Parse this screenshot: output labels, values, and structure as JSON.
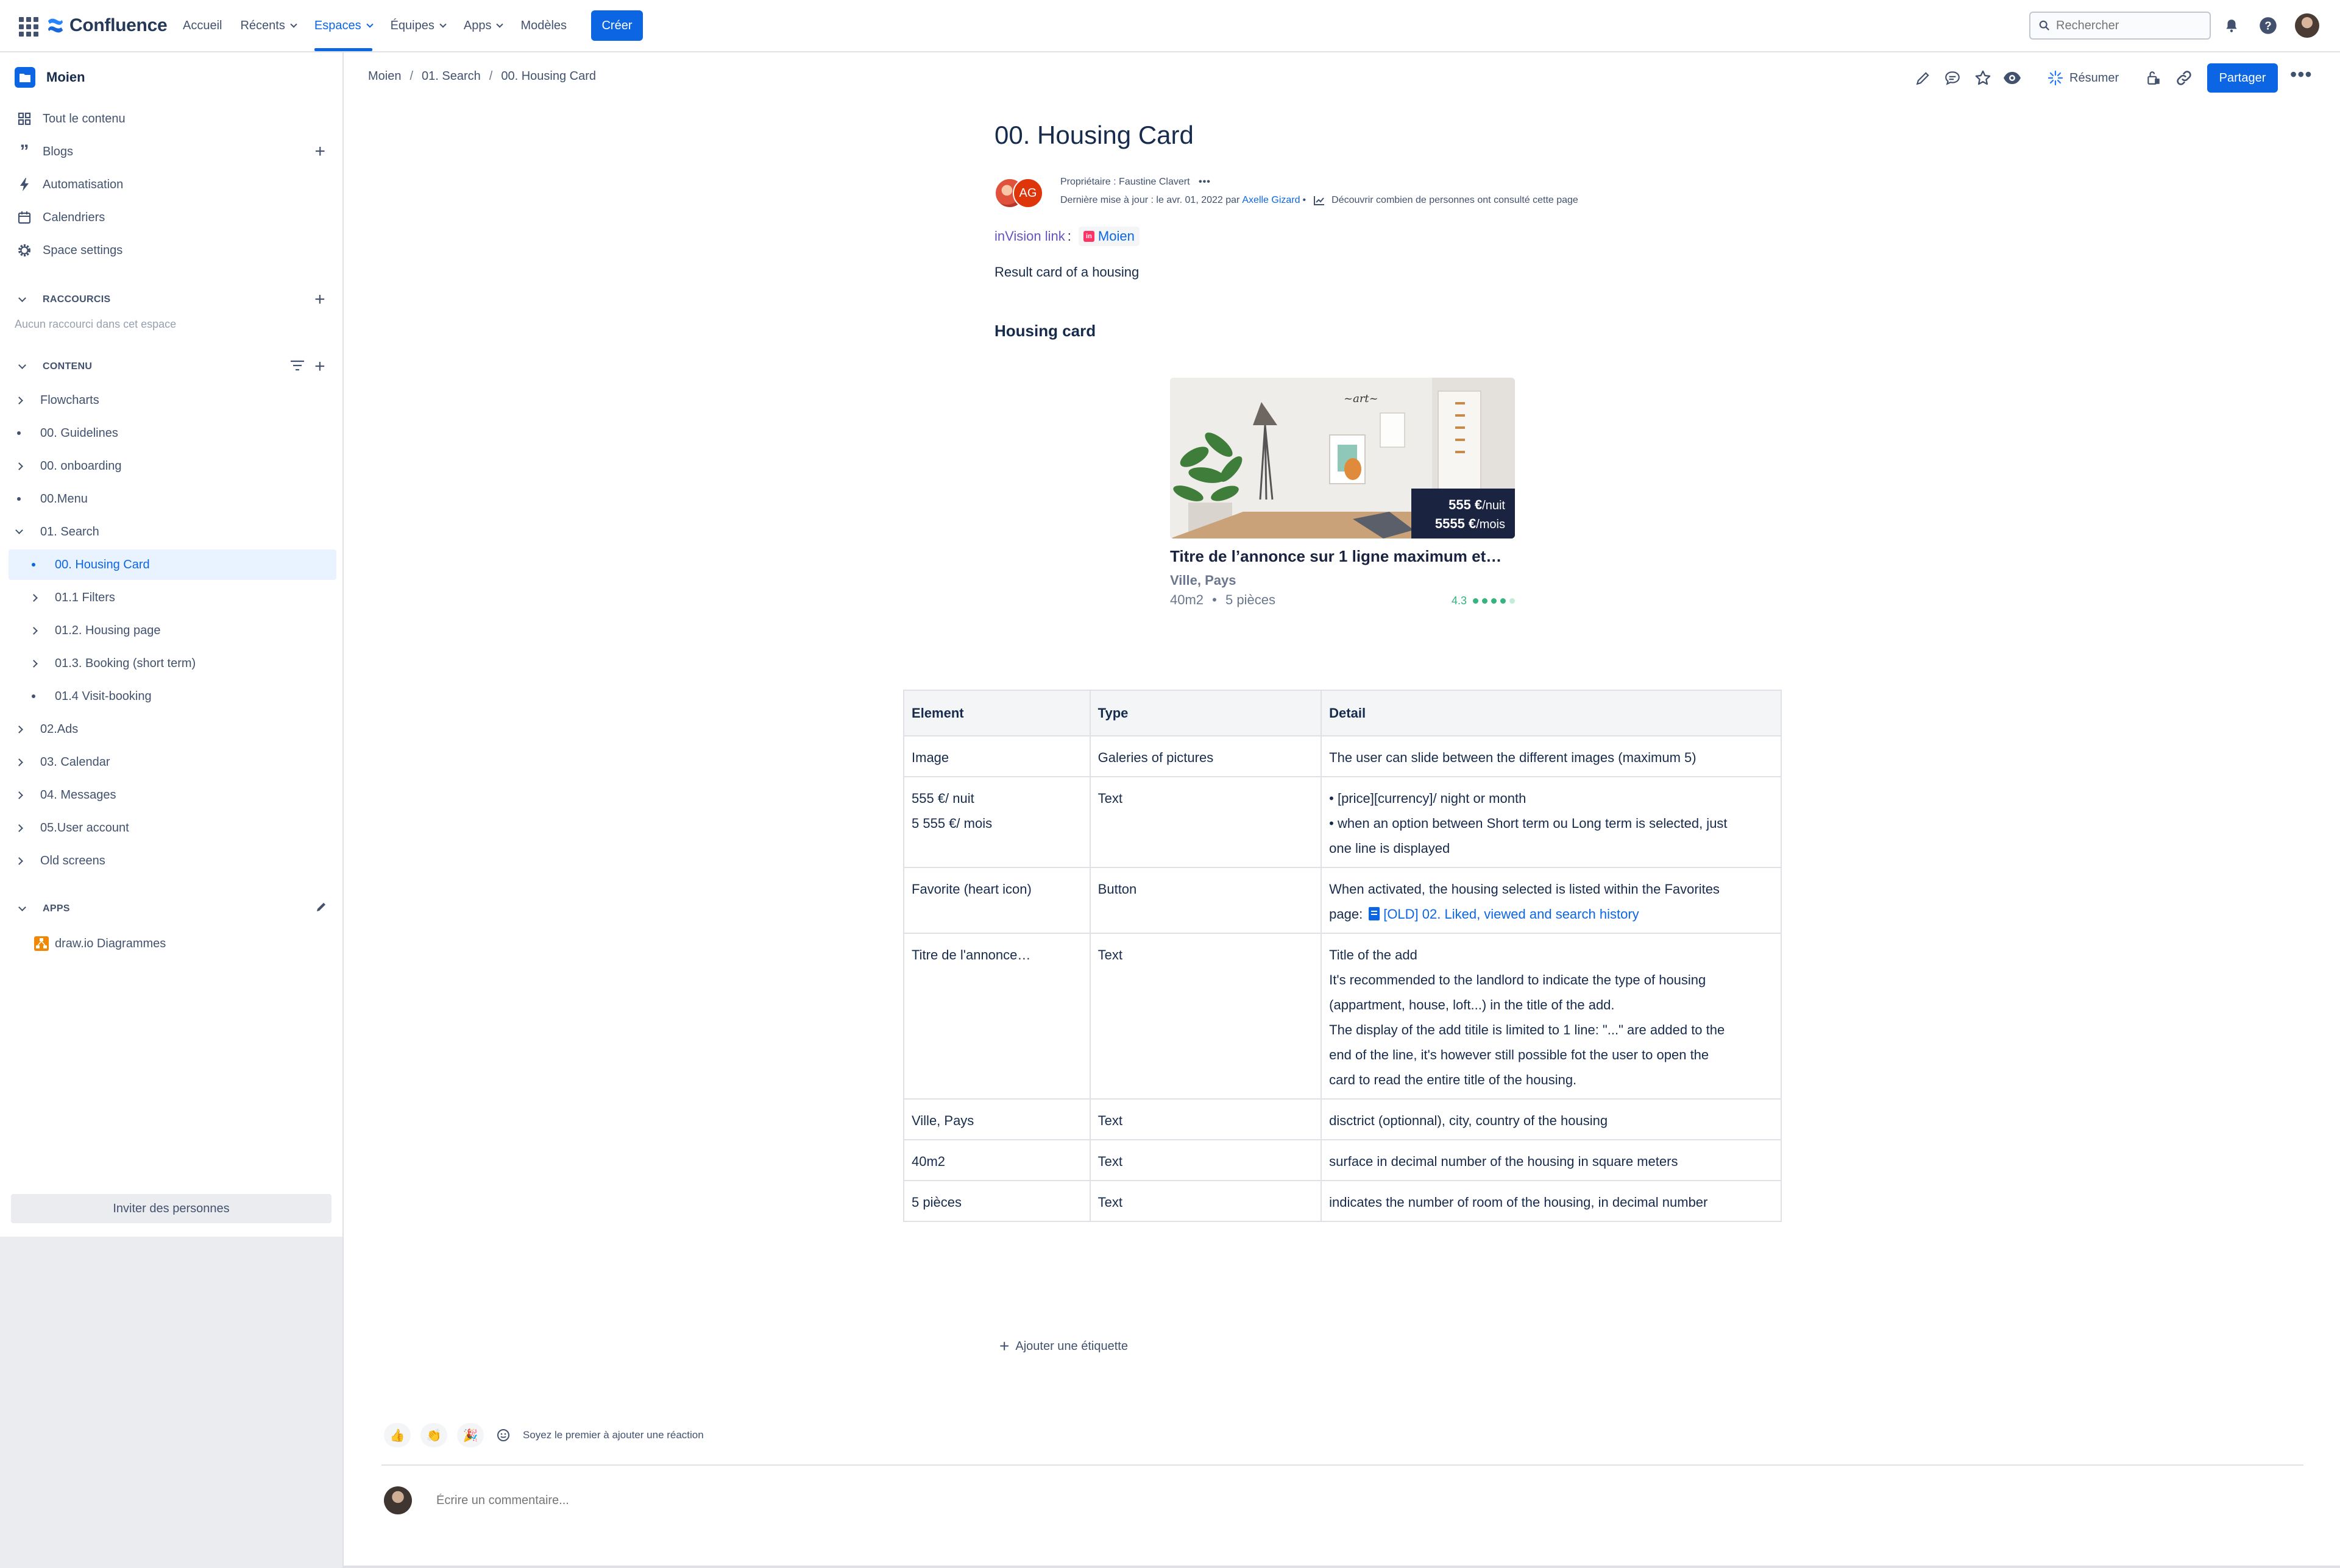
{
  "topnav": {
    "brand": "Confluence",
    "menu": [
      {
        "label": "Accueil",
        "dropdown": false
      },
      {
        "label": "Récents",
        "dropdown": true
      },
      {
        "label": "Espaces",
        "dropdown": true,
        "active": true
      },
      {
        "label": "Équipes",
        "dropdown": true
      },
      {
        "label": "Apps",
        "dropdown": true
      },
      {
        "label": "Modèles",
        "dropdown": false
      }
    ],
    "create_label": "Créer",
    "search_placeholder": "Rechercher",
    "icons": [
      "app-switcher-icon",
      "notifications-icon",
      "help-icon",
      "profile-avatar"
    ],
    "accent": "#0c66e4"
  },
  "sidebar": {
    "space_name": "Moien",
    "items": [
      {
        "label": "Tout le contenu",
        "icon": "all-content-icon"
      },
      {
        "label": "Blogs",
        "icon": "quote-icon"
      },
      {
        "label": "Automatisation",
        "icon": "lightning-icon"
      },
      {
        "label": "Calendriers",
        "icon": "calendar-icon"
      },
      {
        "label": "Space settings",
        "icon": "gear-icon"
      }
    ],
    "shortcuts_title": "RACCOURCIS",
    "shortcuts_empty": "Aucun raccourci dans cet espace",
    "content_title": "CONTENU",
    "tree": [
      {
        "label": "Flowcharts",
        "type": "expand",
        "level": 1
      },
      {
        "label": "00. Guidelines",
        "type": "leaf",
        "level": 1
      },
      {
        "label": "00. onboarding",
        "type": "expand",
        "level": 1
      },
      {
        "label": "00.Menu",
        "type": "leaf",
        "level": 1
      },
      {
        "label": "01. Search",
        "type": "open",
        "level": 1
      },
      {
        "label": "00. Housing Card",
        "type": "leaf",
        "level": 2,
        "selected": true
      },
      {
        "label": "01.1 Filters",
        "type": "expand",
        "level": 2
      },
      {
        "label": "01.2. Housing page",
        "type": "expand",
        "level": 2
      },
      {
        "label": "01.3. Booking (short term)",
        "type": "expand",
        "level": 2
      },
      {
        "label": "01.4 Visit-booking",
        "type": "leaf",
        "level": 2
      },
      {
        "label": "02.Ads",
        "type": "expand",
        "level": 1
      },
      {
        "label": "03. Calendar",
        "type": "expand",
        "level": 1
      },
      {
        "label": "04. Messages",
        "type": "expand",
        "level": 1
      },
      {
        "label": "05.User account",
        "type": "expand",
        "level": 1
      },
      {
        "label": "Old screens",
        "type": "expand",
        "level": 1
      }
    ],
    "apps_title": "APPS",
    "apps": [
      {
        "label": "draw.io Diagrammes",
        "icon": "drawio-icon"
      }
    ],
    "invite_label": "Inviter des personnes"
  },
  "page": {
    "breadcrumb": [
      "Moien",
      "01. Search",
      "00. Housing Card"
    ],
    "resume_label": "Résumer",
    "share_label": "Partager",
    "title": "00. Housing Card",
    "owner_line": "Propriétaire : Faustine Clavert",
    "updated_prefix": "Dernière mise à jour : le avr. 01, 2022 par",
    "updated_author": "Axelle Gizard",
    "analytics_text": "Découvrir combien de personnes ont consulté cette page",
    "avatar_initials": "AG",
    "invision_label": "inVision link",
    "invision_colon": ":",
    "invision_chip": "Moien",
    "result_text": "Result card of a housing",
    "section_heading": "Housing card",
    "housing_card": {
      "price_night": "555 €",
      "price_night_unit": "/nuit",
      "price_month": "5555 €",
      "price_month_unit": "/mois",
      "title": "Titre de l’annonce sur 1 ligne maximum et…",
      "location": "Ville, Pays",
      "surface": "40m2",
      "dot_sep": "•",
      "rooms": "5 pièces",
      "rating": "4.3",
      "rating_value": 4,
      "rating_max": 5
    },
    "table": {
      "headers": [
        "Element",
        "Type",
        "Detail"
      ],
      "rows": [
        {
          "element": [
            "Image"
          ],
          "type": "Galeries of pictures",
          "detail": [
            "The user can slide between the different images (maximum 5)"
          ]
        },
        {
          "element": [
            "555 €/ nuit",
            "5 555 €/ mois"
          ],
          "type": "Text",
          "detail": [
            "• [price][currency]/ night or month",
            "• when an option between Short term ou Long term is selected, just",
            "one line is displayed"
          ]
        },
        {
          "element": [
            "Favorite (heart icon)"
          ],
          "type": "Button",
          "detail": [
            "When activated, the housing selected is listed within the Favorites",
            "page:"
          ],
          "link": "[OLD] 02. Liked, viewed and search history"
        },
        {
          "element": [
            "Titre de l'annonce…"
          ],
          "type": "Text",
          "detail": [
            "Title of the add",
            "It's recommended to the landlord to indicate the type of housing",
            "(appartment, house, loft...) in the title of the add.",
            "The display of the add titile is limited to 1 line: \"...\" are added to the",
            "end of the line, it's however still possible fot the user to open the",
            "card to read the entire title of the housing."
          ]
        },
        {
          "element": [
            "Ville, Pays"
          ],
          "type": "Text",
          "detail": [
            "disctrict (optionnal), city, country of the housing"
          ]
        },
        {
          "element": [
            "40m2"
          ],
          "type": "Text",
          "detail": [
            "surface in decimal number of the housing in square meters"
          ]
        },
        {
          "element": [
            "5 pièces"
          ],
          "type": "Text",
          "detail": [
            "indicates the number of room of the housing, in decimal number"
          ]
        }
      ]
    },
    "add_label_text": "Ajouter une étiquette",
    "reactions": [
      {
        "emoji": "👍",
        "name": "thumbs-up-icon"
      },
      {
        "emoji": "👏",
        "name": "clap-icon"
      },
      {
        "emoji": "🎉",
        "name": "party-icon"
      }
    ],
    "reaction_prompt": "Soyez le premier à ajouter une réaction",
    "comment_placeholder": "Écrire un commentaire..."
  }
}
